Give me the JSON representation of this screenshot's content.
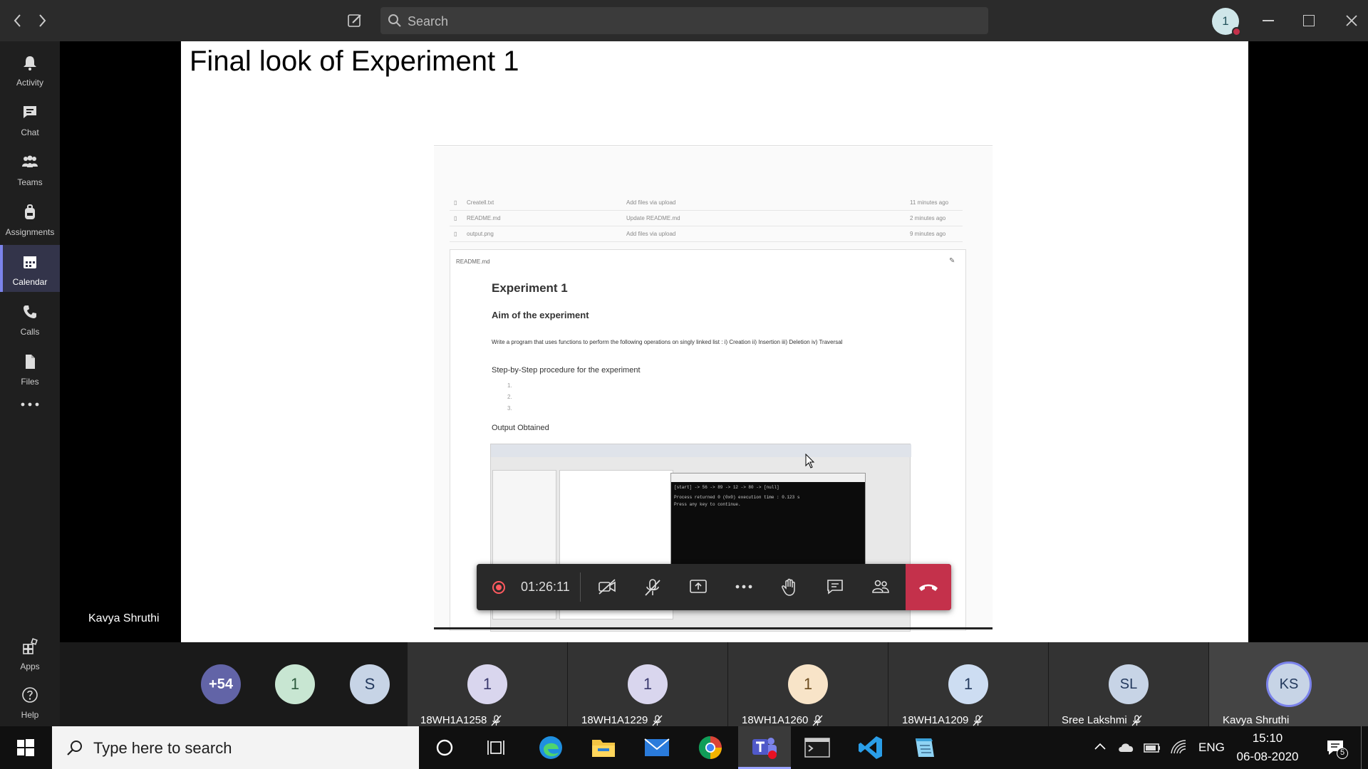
{
  "titlebar": {
    "search_placeholder": "Search",
    "avatar_count": "1",
    "back_icon": "chevron-left-icon",
    "forward_icon": "chevron-right-icon",
    "compose_icon": "compose-icon"
  },
  "rail": {
    "items": [
      {
        "label": "Activity",
        "icon": "bell-icon"
      },
      {
        "label": "Chat",
        "icon": "chat-icon"
      },
      {
        "label": "Teams",
        "icon": "teams-icon"
      },
      {
        "label": "Assignments",
        "icon": "backpack-icon"
      },
      {
        "label": "Calendar",
        "icon": "calendar-icon",
        "active": true
      },
      {
        "label": "Calls",
        "icon": "phone-icon"
      },
      {
        "label": "Files",
        "icon": "files-icon"
      }
    ],
    "more": "...",
    "apps_label": "Apps",
    "help_label": "Help"
  },
  "slide": {
    "title": "Final look of Experiment 1",
    "files": [
      {
        "name": "Createll.txt",
        "commit": "Add files via upload",
        "time": "11 minutes ago"
      },
      {
        "name": "README.md",
        "commit": "Update README.md",
        "time": "2 minutes ago"
      },
      {
        "name": "output.png",
        "commit": "Add files via upload",
        "time": "9 minutes ago"
      }
    ],
    "readme_label": "README.md",
    "heading": "Experiment 1",
    "aim_heading": "Aim of the experiment",
    "aim_text": "Write a program that uses functions to perform the following operations on singly linked list : i) Creation ii) Insertion iii) Deletion iv) Traversal",
    "procedure_heading": "Step-by-Step procedure for the experiment",
    "procedure_items": [
      "1.",
      "2.",
      "3."
    ],
    "output_heading": "Output Obtained",
    "console_lines": [
      "[start] -> 56 -> 89 -> 12 -> 80 -> [null]",
      "Process returned 0 (0x0)   execution time : 0.123 s",
      "Press any key to continue."
    ]
  },
  "meeting": {
    "timer": "01:26:11",
    "presenter": "Kavya Shruthi"
  },
  "participants": [
    {
      "initials": "+54",
      "name": "",
      "bg": "#6264a7",
      "fg": "#ffffff"
    },
    {
      "initials": "1",
      "name": "",
      "bg": "#c8e6d2",
      "fg": "#2d5a3d"
    },
    {
      "initials": "S",
      "name": "",
      "bg": "#c7d4e6",
      "fg": "#243a5e"
    },
    {
      "initials": "1",
      "name": "18WH1A1258",
      "bg": "#d9d6ee",
      "fg": "#3b3a6e"
    },
    {
      "initials": "1",
      "name": "18WH1A1229",
      "bg": "#d9d6ee",
      "fg": "#3b3a6e"
    },
    {
      "initials": "1",
      "name": "18WH1A1260",
      "bg": "#f8e4c8",
      "fg": "#6b4b1e"
    },
    {
      "initials": "1",
      "name": "18WH1A1209",
      "bg": "#cdddf2",
      "fg": "#243a5e"
    },
    {
      "initials": "SL",
      "name": "Sree Lakshmi",
      "bg": "#c7d4e6",
      "fg": "#243a5e"
    },
    {
      "initials": "KS",
      "name": "Kavya Shruthi",
      "bg": "#c7d4e6",
      "fg": "#243a5e"
    }
  ],
  "taskbar": {
    "search_placeholder": "Type here to search",
    "lang": "ENG",
    "time": "15:10",
    "date": "06-08-2020",
    "notification_count": "5"
  },
  "colors": {
    "accent": "#7b83eb",
    "leave": "#c4314b",
    "record": "#ff5a5f"
  }
}
